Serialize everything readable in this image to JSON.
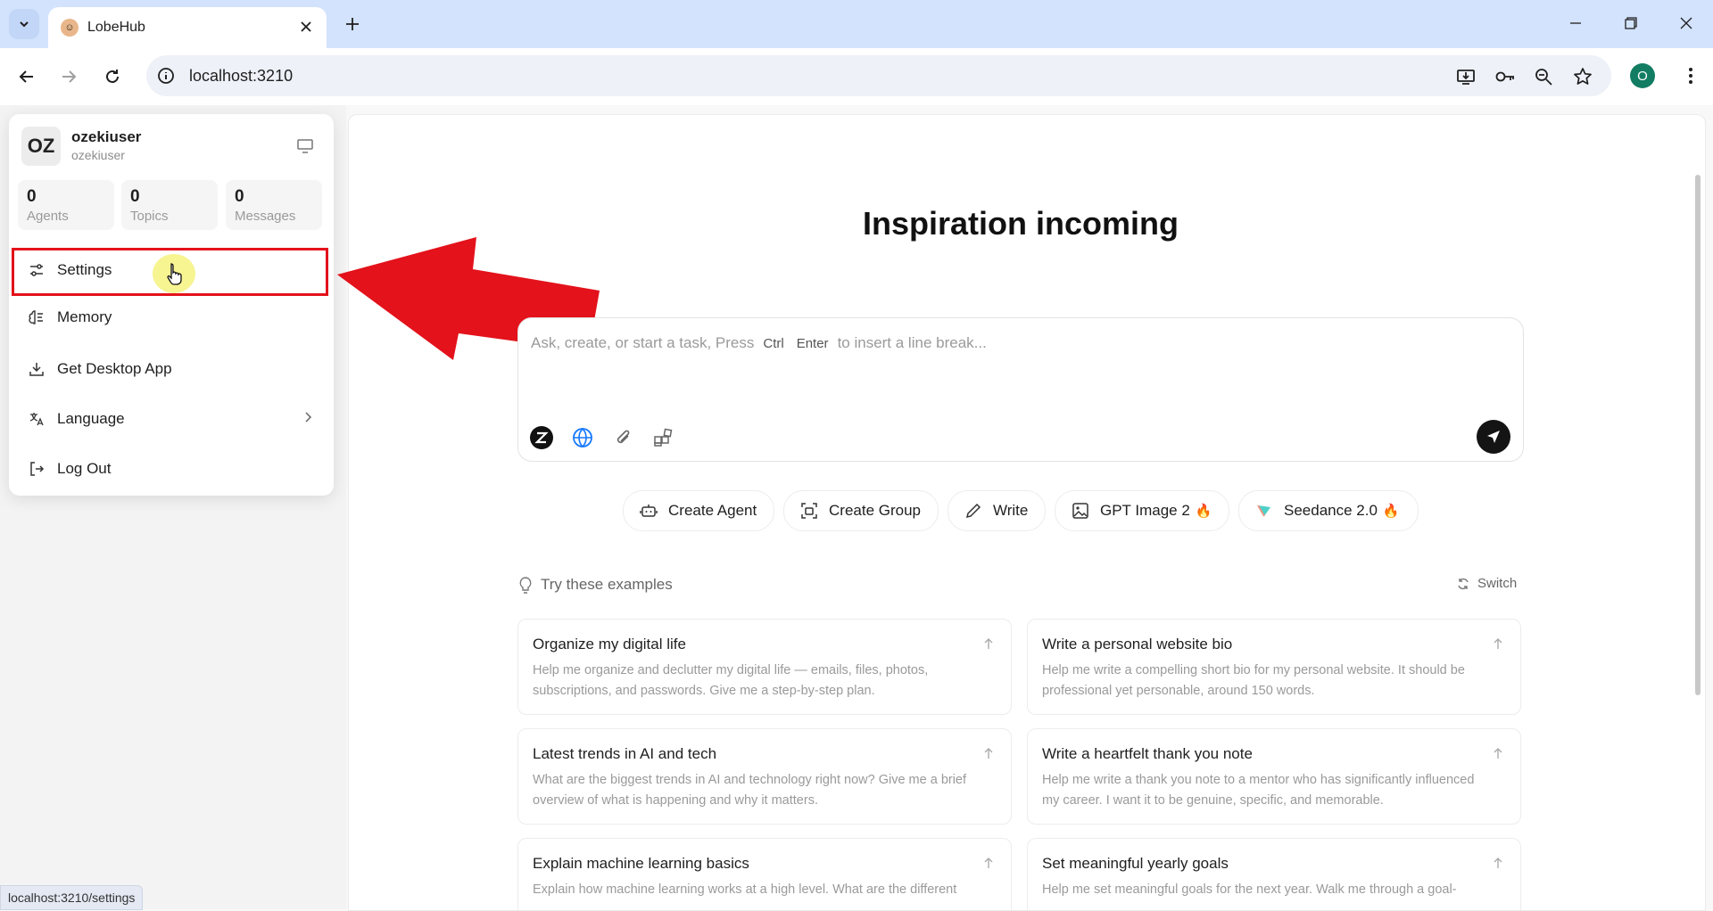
{
  "browser": {
    "tab_title": "LobeHub",
    "url": "localhost:3210",
    "profile_initial": "O",
    "status_url": "localhost:3210/settings"
  },
  "user": {
    "avatar_initials": "OZ",
    "name": "ozekiuser",
    "handle": "ozekiuser",
    "stats": [
      {
        "value": "0",
        "label": "Agents"
      },
      {
        "value": "0",
        "label": "Topics"
      },
      {
        "value": "0",
        "label": "Messages"
      }
    ]
  },
  "menu": {
    "settings": "Settings",
    "memory": "Memory",
    "desktop_app": "Get Desktop App",
    "language": "Language",
    "logout": "Log Out"
  },
  "hero": {
    "title": "Inspiration incoming",
    "placeholder_start": "Ask, create, or start a task, Press",
    "key_ctrl": "Ctrl",
    "key_enter": "Enter",
    "placeholder_end": "to insert a line break..."
  },
  "chips": [
    {
      "label": "Create Agent",
      "icon": "robot-icon"
    },
    {
      "label": "Create Group",
      "icon": "group-icon"
    },
    {
      "label": "Write",
      "icon": "pen-icon"
    },
    {
      "label": "GPT Image 2",
      "icon": "image-icon",
      "hot": true
    },
    {
      "label": "Seedance 2.0",
      "icon": "seedance-icon",
      "hot": true
    }
  ],
  "examples": {
    "heading": "Try these examples",
    "switch_label": "Switch",
    "cards": [
      {
        "title": "Organize my digital life",
        "desc": "Help me organize and declutter my digital life — emails, files, photos, subscriptions, and passwords. Give me a step-by-step plan."
      },
      {
        "title": "Write a personal website bio",
        "desc": "Help me write a compelling short bio for my personal website. It should be professional yet personable, around 150 words."
      },
      {
        "title": "Latest trends in AI and tech",
        "desc": "What are the biggest trends in AI and technology right now? Give me a brief overview of what is happening and why it matters."
      },
      {
        "title": "Write a heartfelt thank you note",
        "desc": "Help me write a thank you note to a mentor who has significantly influenced my career. I want it to be genuine, specific, and memorable."
      },
      {
        "title": "Explain machine learning basics",
        "desc": "Explain how machine learning works at a high level. What are the different"
      },
      {
        "title": "Set meaningful yearly goals",
        "desc": "Help me set meaningful goals for the next year. Walk me through a goal-"
      }
    ]
  },
  "colors": {
    "tabstrip": "#d3e3fd",
    "highlight": "#e3121b",
    "profile": "#127d63"
  }
}
